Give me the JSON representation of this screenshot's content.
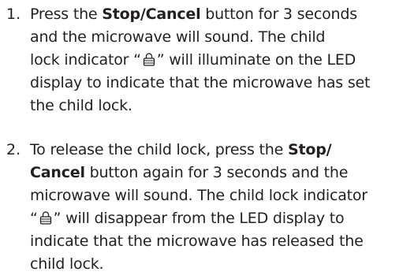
{
  "steps": [
    {
      "number": "1.",
      "l1_a": "Press the ",
      "l1_b": "Stop/Cancel",
      "l1_c": " button for 3 seconds",
      "l2": "and the microwave will sound. The child",
      "l3_a": "lock indicator “",
      "l3_b": "” will illuminate on the LED",
      "l4": "display to indicate that the microwave has set",
      "l5": "the child lock."
    },
    {
      "number": "2.",
      "l1_a": "To release the child lock, press the ",
      "l1_b": "Stop/",
      "l2_a": "Cancel",
      "l2_b": " button again for 3 seconds and the",
      "l3": "microwave will sound. The child lock indicator",
      "l4_a": "“",
      "l4_b": "” will disappear from the LED display to",
      "l5": "indicate that the microwave has released the",
      "l6": "child lock."
    }
  ],
  "icons": {
    "lock": "child-lock-icon"
  },
  "colors": {
    "text": "#231f20"
  }
}
